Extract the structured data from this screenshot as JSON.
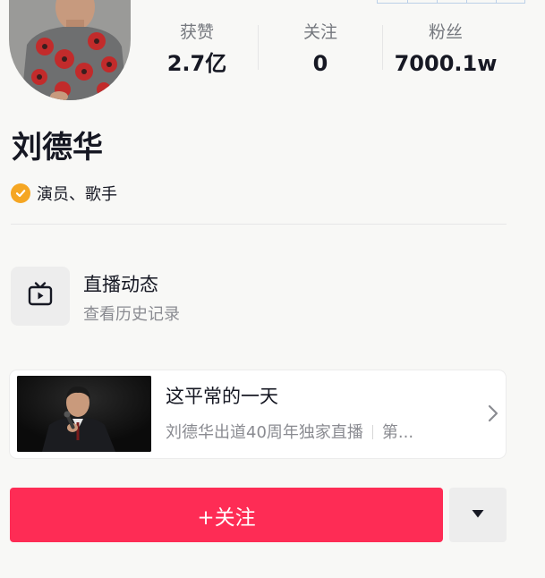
{
  "profile": {
    "name": "刘德华",
    "verification": {
      "icon": "verified-check-icon",
      "text": "演员、歌手",
      "color": "#f5a623"
    }
  },
  "stats": [
    {
      "label": "获赞",
      "value": "2.7亿"
    },
    {
      "label": "关注",
      "value": "0"
    },
    {
      "label": "粉丝",
      "value": "7000.1w"
    }
  ],
  "live_history": {
    "icon": "tv-play-icon",
    "title": "直播动态",
    "subtitle": "查看历史记录"
  },
  "featured": {
    "title": "这平常的一天",
    "subtitle_main": "刘德华出道40周年独家直播",
    "subtitle_tail": "第...",
    "chevron_icon": "chevron-right-icon"
  },
  "actions": {
    "follow_label": "+关注",
    "more_icon": "triangle-down-icon",
    "accent": "#fe2c55"
  }
}
